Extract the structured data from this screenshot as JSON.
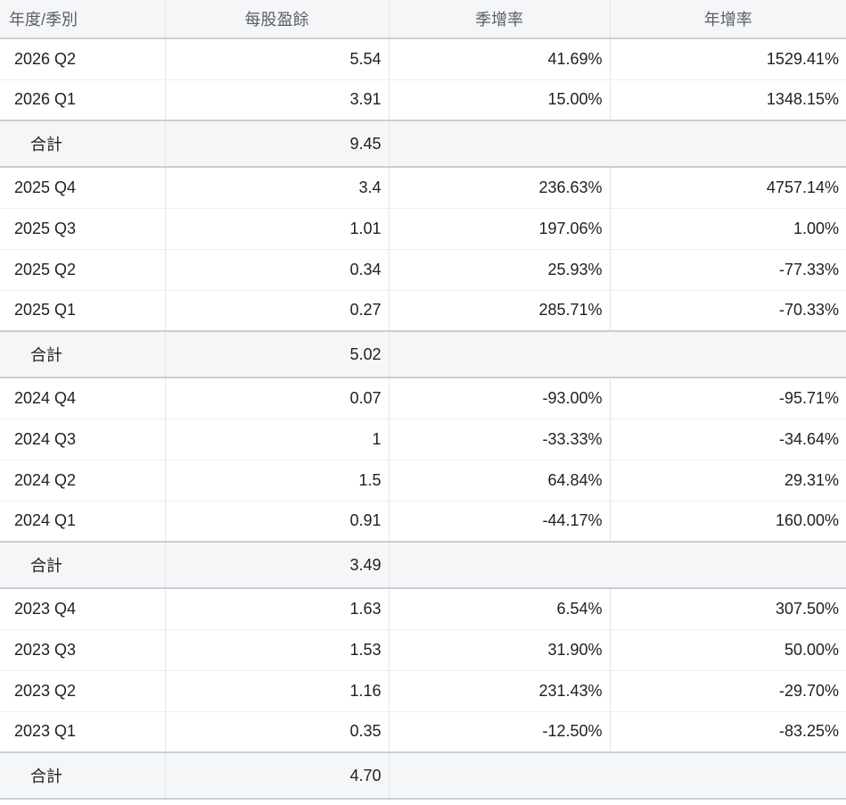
{
  "headers": [
    "年度/季別",
    "每股盈餘",
    "季增率",
    "年增率"
  ],
  "total_label": "合計",
  "groups": [
    {
      "rows": [
        {
          "period": "2026 Q2",
          "eps": "5.54",
          "qoq": "41.69%",
          "yoy": "1529.41%"
        },
        {
          "period": "2026 Q1",
          "eps": "3.91",
          "qoq": "15.00%",
          "yoy": "1348.15%"
        }
      ],
      "total": "9.45"
    },
    {
      "rows": [
        {
          "period": "2025 Q4",
          "eps": "3.4",
          "qoq": "236.63%",
          "yoy": "4757.14%"
        },
        {
          "period": "2025 Q3",
          "eps": "1.01",
          "qoq": "197.06%",
          "yoy": "1.00%"
        },
        {
          "period": "2025 Q2",
          "eps": "0.34",
          "qoq": "25.93%",
          "yoy": "-77.33%"
        },
        {
          "period": "2025 Q1",
          "eps": "0.27",
          "qoq": "285.71%",
          "yoy": "-70.33%"
        }
      ],
      "total": "5.02"
    },
    {
      "rows": [
        {
          "period": "2024 Q4",
          "eps": "0.07",
          "qoq": "-93.00%",
          "yoy": "-95.71%"
        },
        {
          "period": "2024 Q3",
          "eps": "1",
          "qoq": "-33.33%",
          "yoy": "-34.64%"
        },
        {
          "period": "2024 Q2",
          "eps": "1.5",
          "qoq": "64.84%",
          "yoy": "29.31%"
        },
        {
          "period": "2024 Q1",
          "eps": "0.91",
          "qoq": "-44.17%",
          "yoy": "160.00%"
        }
      ],
      "total": "3.49"
    },
    {
      "rows": [
        {
          "period": "2023 Q4",
          "eps": "1.63",
          "qoq": "6.54%",
          "yoy": "307.50%"
        },
        {
          "period": "2023 Q3",
          "eps": "1.53",
          "qoq": "31.90%",
          "yoy": "50.00%"
        },
        {
          "period": "2023 Q2",
          "eps": "1.16",
          "qoq": "231.43%",
          "yoy": "-29.70%"
        },
        {
          "period": "2023 Q1",
          "eps": "0.35",
          "qoq": "-12.50%",
          "yoy": "-83.25%"
        }
      ],
      "total": "4.70"
    }
  ]
}
